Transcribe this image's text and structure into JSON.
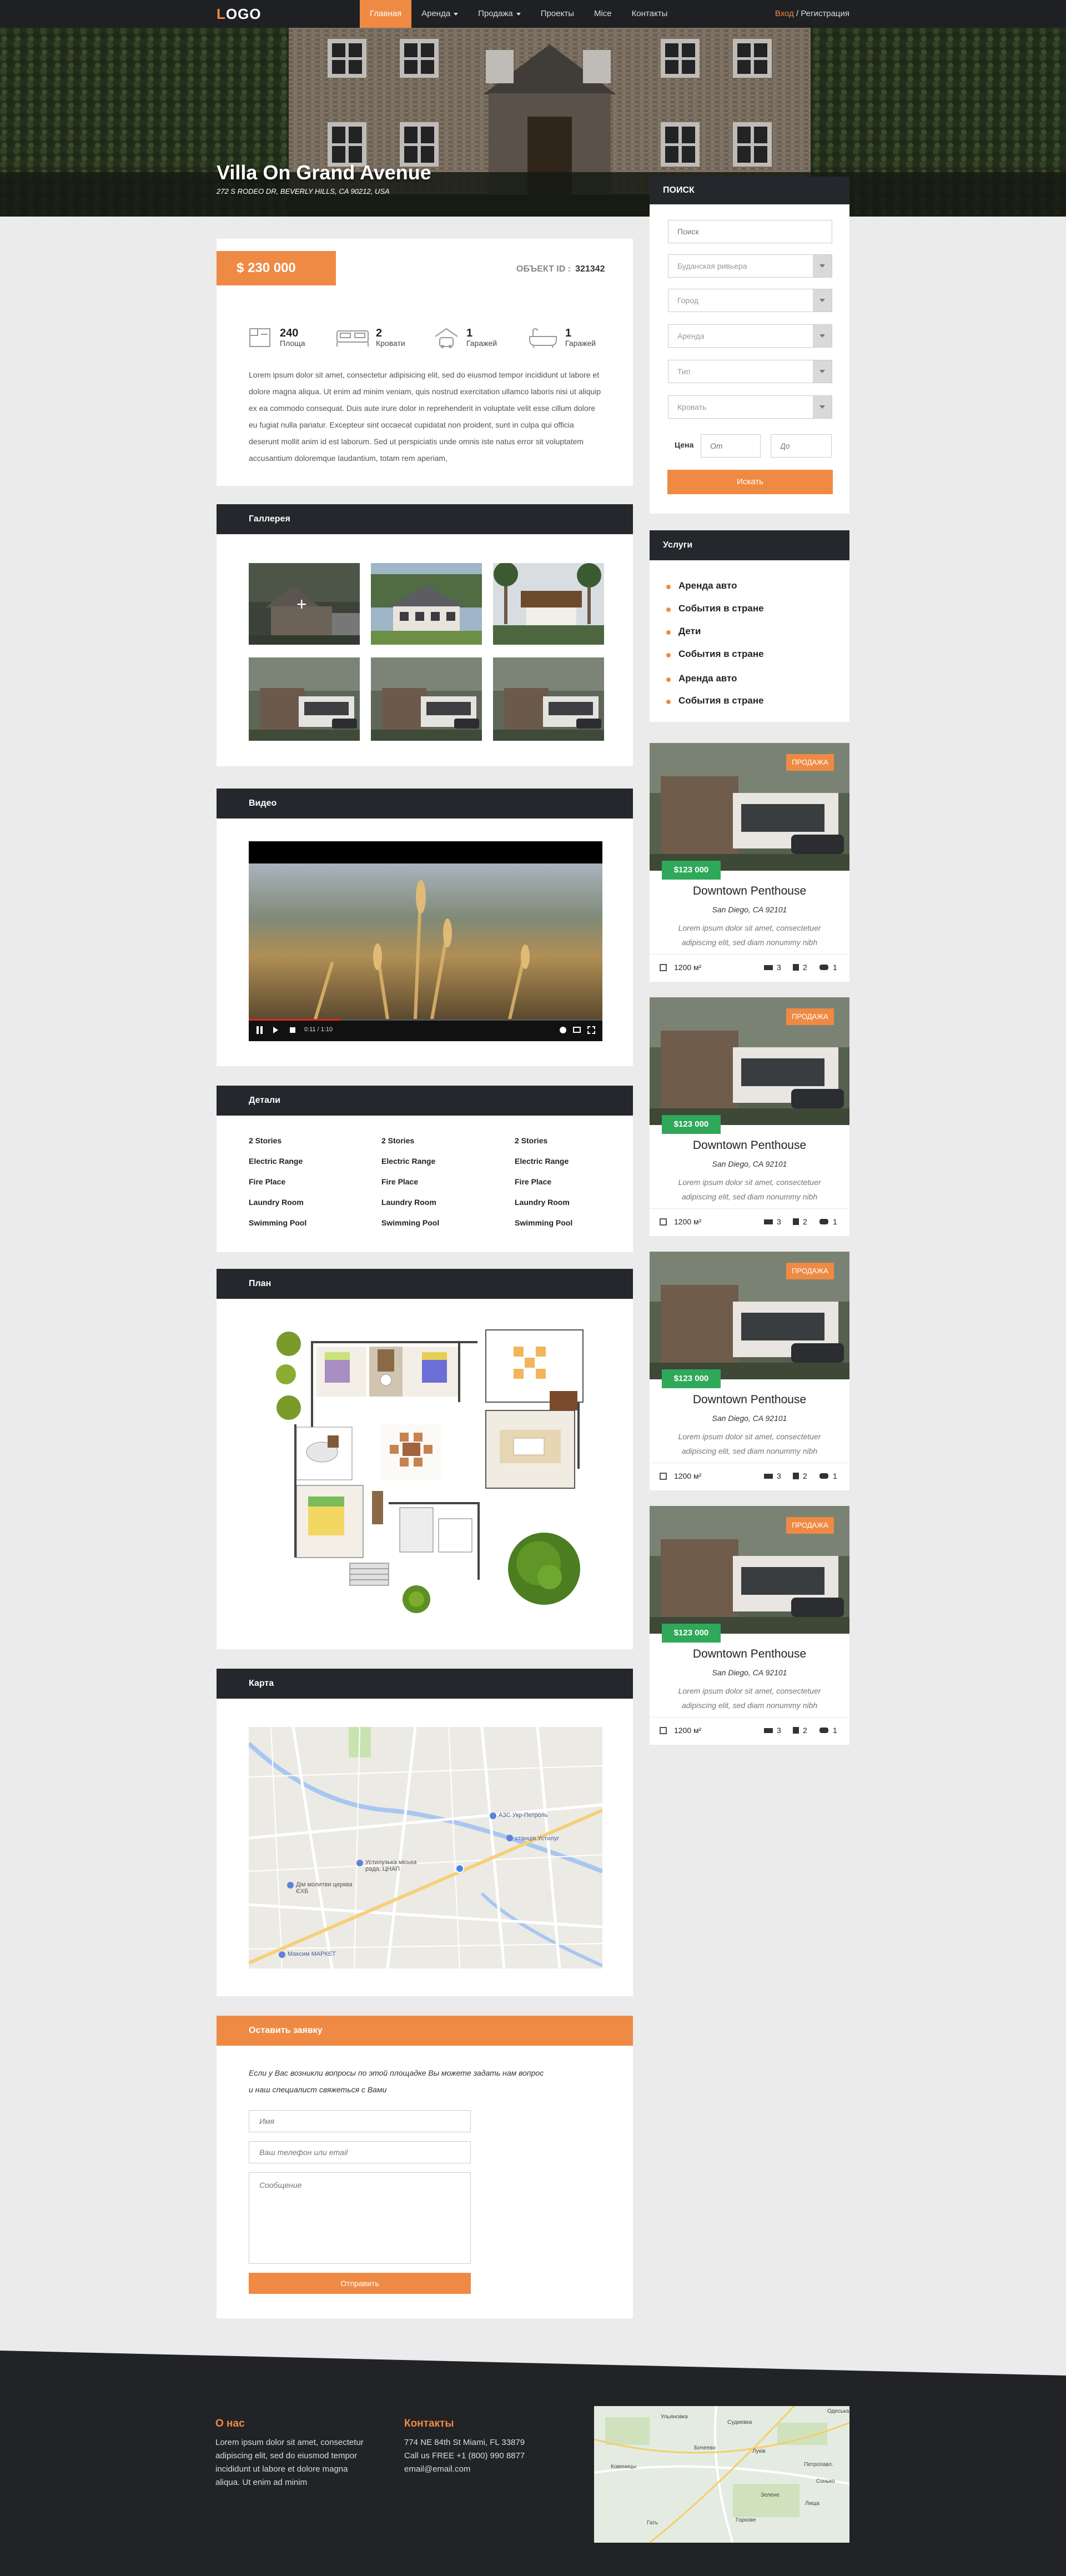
{
  "header": {
    "logo_first": "L",
    "logo_rest": "OGO",
    "nav": [
      {
        "label": "Главная",
        "active": true
      },
      {
        "label": "Аренда",
        "dropdown": true
      },
      {
        "label": "Продажа",
        "dropdown": true
      },
      {
        "label": "Проекты"
      },
      {
        "label": "Mice"
      },
      {
        "label": "Контакты"
      }
    ],
    "login": "Вход",
    "separator": "/",
    "register": "Регистрация"
  },
  "hero": {
    "title": "Villa On Grand Avenue",
    "address": "272 S RODEO DR, BEVERLY HILLS, CA 90212, USA"
  },
  "summary": {
    "price": "$ 230 000",
    "object_id_label": "ОБЪЕКТ ID :",
    "object_id": "321342",
    "features": [
      {
        "icon": "area-icon",
        "value": "240",
        "label": "Площа"
      },
      {
        "icon": "bed-icon",
        "value": "2",
        "label": "Кровати"
      },
      {
        "icon": "garage-icon",
        "value": "1",
        "label": "Гаражей"
      },
      {
        "icon": "bath-icon",
        "value": "1",
        "label": "Гаражей"
      }
    ],
    "description": "Lorem ipsum dolor sit amet, consectetur adipisicing elit, sed do eiusmod tempor incididunt ut labore et dolore magna aliqua. Ut enim ad minim veniam, quis nostrud exercitation ullamco laboris nisi ut aliquip ex ea commodo consequat. Duis aute irure dolor in reprehenderit in voluptate velit esse cillum dolore eu fugiat nulla pariatur. Excepteur sint occaecat cupidatat non proident, sunt in culpa qui officia deserunt mollit anim id est laborum. Sed ut perspiciatis unde omnis iste natus error sit voluptatem accusantium doloremque laudantium, totam rem aperiam,"
  },
  "gallery": {
    "title": "Галлерея",
    "zoom_symbol": "+"
  },
  "video": {
    "title": "Видео",
    "time": "0:11 / 1:10"
  },
  "details": {
    "title": "Детали",
    "columns": [
      [
        "2 Stories",
        "Electric Range",
        "Fire Place",
        "Laundry Room",
        "Swimming Pool"
      ],
      [
        "2 Stories",
        "Electric Range",
        "Fire Place",
        "Laundry Room",
        "Swimming Pool"
      ],
      [
        "2 Stories",
        "Electric Range",
        "Fire Place",
        "Laundry Room",
        "Swimming Pool"
      ]
    ]
  },
  "plan": {
    "title": "План"
  },
  "map": {
    "title": "Карта",
    "labels": [
      "АЗС Укр-Петроль",
      "станція Устилуг",
      "Устилузька міська рада, ЦНАП",
      "Дім молитви церква ЄХБ",
      "Максим МАРКЕТ"
    ]
  },
  "request": {
    "title": "Оставить заявку",
    "intro": "Если у Вас возникли вопросы по этой площадке Вы можете задать нам вопрос и наш специалист свяжеться с Вами",
    "name_placeholder": "Имя",
    "contact_placeholder": "Ваш телефон или email",
    "message_placeholder": "Сообщение",
    "submit": "Отправить"
  },
  "search": {
    "title": "ПОИСК",
    "input_placeholder": "Поиск",
    "selects": [
      "Буданская ривьера",
      "Город",
      "Аренда",
      "Тип",
      "Кровать"
    ],
    "price_label": "Цена",
    "from_placeholder": "От",
    "to_placeholder": "До",
    "submit": "Искать"
  },
  "services": {
    "title": "Услуги",
    "items": [
      "Аренда авто",
      "События в стране",
      "Дети",
      "События в стране",
      "Аренда авто",
      "События в стране"
    ]
  },
  "listings": [
    {
      "tag": "ПРОДАЖА",
      "price": "$123 000",
      "title": "Downtown Penthouse",
      "address": "San Diego, CA 92101",
      "description": "Lorem ipsum dolor sit amet, consectetuer adipiscing elit, sed diam nonummy nibh",
      "area": "1200 м²",
      "beds": "3",
      "baths": "2",
      "cars": "1"
    },
    {
      "tag": "ПРОДАЖА",
      "price": "$123 000",
      "title": "Downtown Penthouse",
      "address": "San Diego, CA 92101",
      "description": "Lorem ipsum dolor sit amet, consectetuer adipiscing elit, sed diam nonummy nibh",
      "area": "1200 м²",
      "beds": "3",
      "baths": "2",
      "cars": "1"
    },
    {
      "tag": "ПРОДАЖА",
      "price": "$123 000",
      "title": "Downtown Penthouse",
      "address": "San Diego, CA 92101",
      "description": "Lorem ipsum dolor sit amet, consectetuer adipiscing elit, sed diam nonummy nibh",
      "area": "1200 м²",
      "beds": "3",
      "baths": "2",
      "cars": "1"
    },
    {
      "tag": "ПРОДАЖА",
      "price": "$123 000",
      "title": "Downtown Penthouse",
      "address": "San Diego, CA 92101",
      "description": "Lorem ipsum dolor sit amet, consectetuer adipiscing elit, sed diam nonummy nibh",
      "area": "1200 м²",
      "beds": "3",
      "baths": "2",
      "cars": "1"
    }
  ],
  "footer": {
    "about_title": "О нас",
    "about_text": "Lorem ipsum dolor sit amet, consectetur adipiscing elit, sed do eiusmod tempor incididunt ut labore et dolore magna aliqua. Ut enim ad minim",
    "contacts_title": "Контакты",
    "address": "774 NE 84th St Miami, FL 33879",
    "phone": "Call us FREE +1 (800) 990 8877",
    "email": "email@email.com",
    "map_labels": [
      "Ульяновка",
      "Судиевка",
      "Одеська",
      "Бочеево",
      "Петропавл.",
      "Ковеницы",
      "Луків",
      "Сонько",
      "Зелене",
      "Гать",
      "Горкове",
      "Лища"
    ]
  },
  "colors": {
    "accent": "#ef8a44",
    "dark": "#24272b",
    "price_green": "#2fa85a",
    "background": "#ebebeb"
  }
}
